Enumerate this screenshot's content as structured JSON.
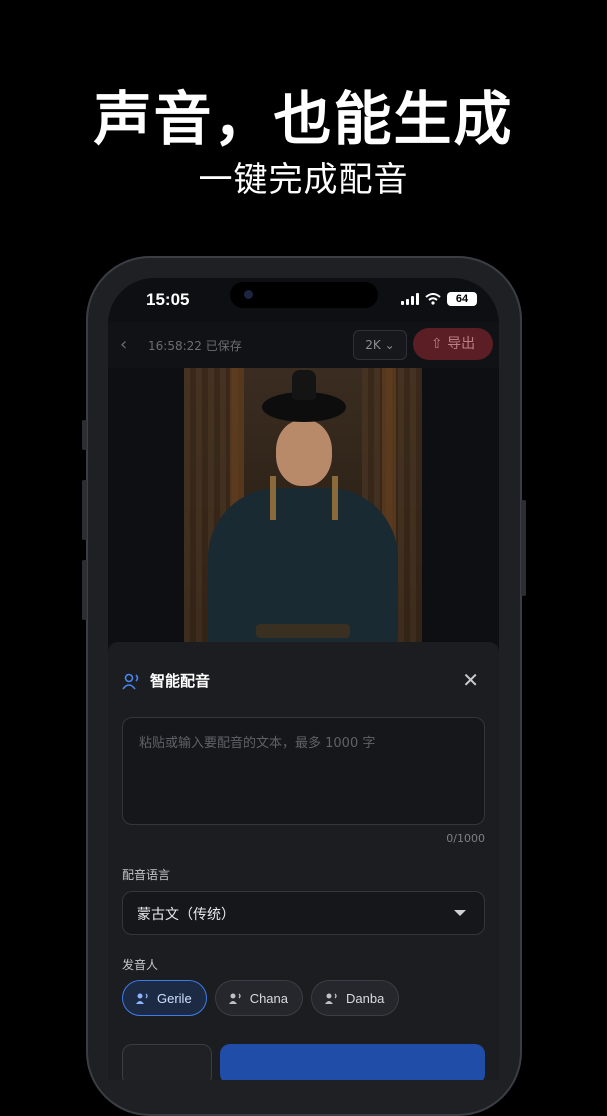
{
  "promo": {
    "headline": "声音，也能生成",
    "subline": "一键完成配音"
  },
  "status_bar": {
    "time": "15:05",
    "battery": "64"
  },
  "app_bar": {
    "saved_text": "16:58:22 已保存",
    "resolution": "2K",
    "export_label": "导出"
  },
  "sheet": {
    "title": "智能配音",
    "text_placeholder": "粘贴或输入要配音的文本，最多 1000 字",
    "counter": "0/1000",
    "language_label": "配音语言",
    "language_value": "蒙古文（传统）",
    "speaker_label": "发音人",
    "speakers": [
      {
        "name": "Gerile",
        "selected": true
      },
      {
        "name": "Chana",
        "selected": false
      },
      {
        "name": "Danba",
        "selected": false
      }
    ]
  },
  "colors": {
    "accent": "#3e7bea",
    "export": "#5a1e24"
  }
}
